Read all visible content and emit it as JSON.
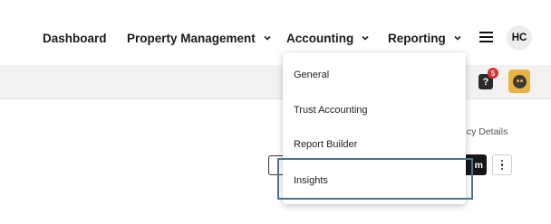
{
  "nav": {
    "items": [
      {
        "label": "Dashboard",
        "has_caret": false
      },
      {
        "label": "Property Management",
        "has_caret": true
      },
      {
        "label": "Accounting",
        "has_caret": true
      },
      {
        "label": "Reporting",
        "has_caret": true
      }
    ],
    "menu_icon": "hamburger-icon",
    "avatar_initials": "HC"
  },
  "subbar": {
    "help_icon": "help-question-icon",
    "help_badge_count": "5",
    "help_glyph": "?",
    "assistant_icon": "assistant-face-icon"
  },
  "page": {
    "partial_link": "ncy Details",
    "dark_button_partial": "m"
  },
  "accounting_menu": {
    "items": [
      {
        "label": "General"
      },
      {
        "label": "Trust Accounting"
      },
      {
        "label": "Report Builder"
      },
      {
        "label": "Insights",
        "highlighted": true
      }
    ]
  },
  "colors": {
    "highlight_border": "#4d7484",
    "badge": "#d9302f",
    "assistant": "#e8b33f",
    "subbar_bg": "#f3f2f1"
  }
}
